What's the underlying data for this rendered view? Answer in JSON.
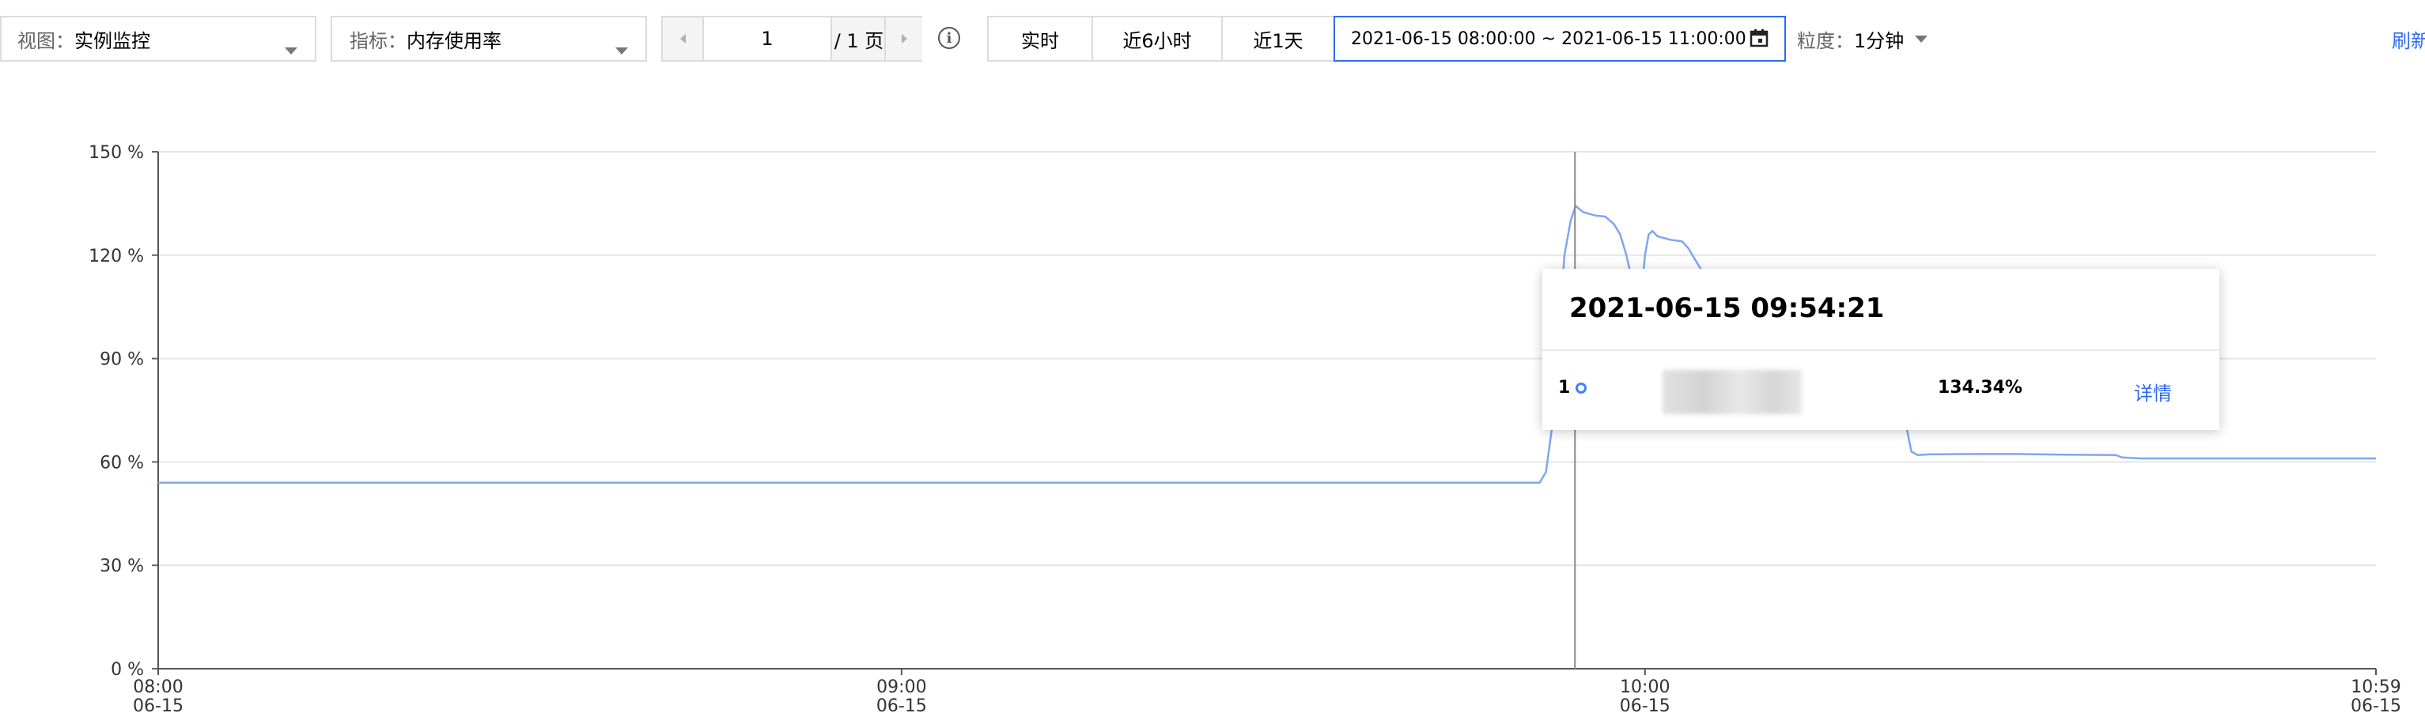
{
  "toolbar": {
    "view": {
      "label": "视图：",
      "value": "实例监控"
    },
    "metric": {
      "label": "指标：",
      "value": "内存使用率"
    },
    "pager": {
      "page_input": "1",
      "total": "/ 1 页"
    },
    "time_buttons": [
      "实时",
      "近6小时",
      "近1天"
    ],
    "date_range": "2021-06-15 08:00:00 ~ 2021-06-15 11:00:00",
    "granularity": {
      "label": "粒度：",
      "value": "1分钟"
    },
    "refresh": "刷新"
  },
  "icons": {
    "prev": "chevron-left-icon",
    "next": "chevron-right-icon",
    "info": "info-icon",
    "calendar": "calendar-icon",
    "dropdown": "caret-down-icon"
  },
  "colors": {
    "accent": "#2f6cf0",
    "series": "#7ea6f0",
    "grid": "#e6e6e6"
  },
  "chart_data": {
    "type": "line",
    "ylim": [
      0,
      150
    ],
    "y_ticks": [
      "0 %",
      "30 %",
      "60 %",
      "90 %",
      "120 %",
      "150 %"
    ],
    "x_ticks": [
      {
        "time": "08:00",
        "date": "06-15",
        "min": 0
      },
      {
        "time": "09:00",
        "date": "06-15",
        "min": 60
      },
      {
        "time": "10:00",
        "date": "06-15",
        "min": 120
      },
      {
        "time": "10:59",
        "date": "06-15",
        "min": 179
      }
    ],
    "xlim": [
      0,
      179
    ],
    "cursor_min": 114.35,
    "series": [
      {
        "points": [
          [
            0,
            54
          ],
          [
            111.5,
            54
          ],
          [
            112,
            57
          ],
          [
            112.5,
            70
          ],
          [
            113,
            95
          ],
          [
            113.5,
            120
          ],
          [
            114,
            130
          ],
          [
            114.4,
            134.3
          ],
          [
            115,
            132.5
          ],
          [
            116,
            131.5
          ],
          [
            116.8,
            131.2
          ],
          [
            117.5,
            129
          ],
          [
            118,
            126
          ],
          [
            118.5,
            120
          ],
          [
            119,
            112
          ],
          [
            119.4,
            108
          ],
          [
            119.8,
            112
          ],
          [
            120,
            120
          ],
          [
            120.3,
            126
          ],
          [
            120.6,
            127
          ],
          [
            121,
            125.5
          ],
          [
            122,
            124.5
          ],
          [
            123,
            124
          ],
          [
            123.5,
            122
          ],
          [
            124,
            119
          ],
          [
            124.5,
            116
          ],
          [
            125,
            114
          ],
          [
            139,
            114
          ],
          [
            140,
            95
          ],
          [
            141,
            72
          ],
          [
            141.5,
            63
          ],
          [
            142,
            62
          ],
          [
            143,
            62.2
          ],
          [
            147,
            62.3
          ],
          [
            150,
            62.3
          ],
          [
            154,
            62.1
          ],
          [
            158,
            62
          ],
          [
            158.5,
            61.3
          ],
          [
            160,
            61
          ],
          [
            165,
            61
          ],
          [
            170,
            61
          ],
          [
            179,
            61
          ]
        ]
      }
    ]
  },
  "tooltip": {
    "title": "2021-06-15 09:54:21",
    "index": "1",
    "value": "134.34%",
    "link": "详情"
  }
}
